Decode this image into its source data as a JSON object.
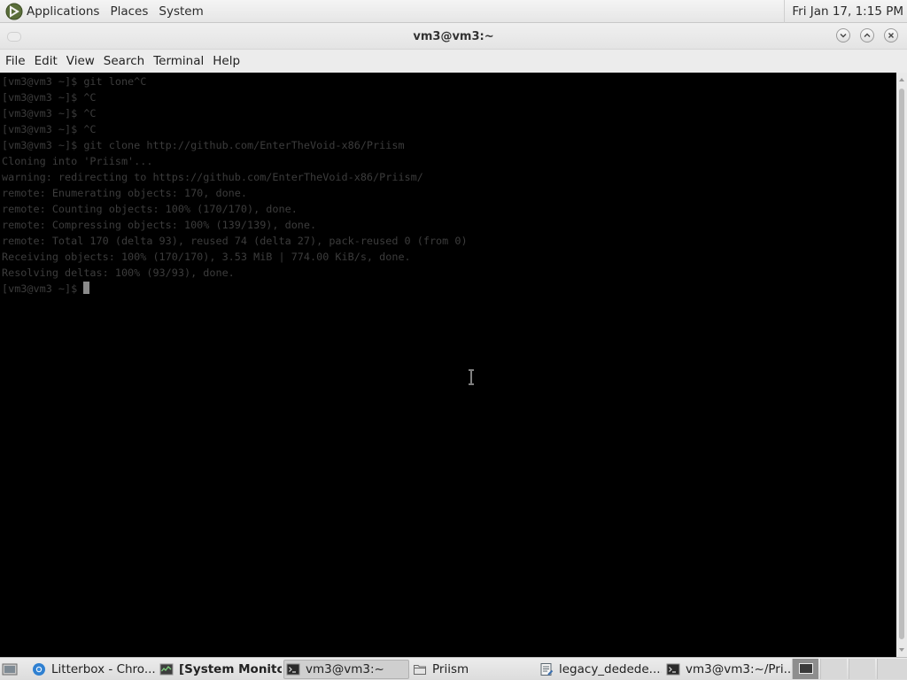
{
  "top_panel": {
    "menus": [
      "Applications",
      "Places",
      "System"
    ],
    "clock": "Fri Jan 17,  1:15 PM"
  },
  "window": {
    "title": "vm3@vm3:~"
  },
  "menubar": {
    "items": [
      "File",
      "Edit",
      "View",
      "Search",
      "Terminal",
      "Help"
    ]
  },
  "terminal": {
    "lines": [
      "[vm3@vm3 ~]$ git lone^C",
      "[vm3@vm3 ~]$ ^C",
      "[vm3@vm3 ~]$ ^C",
      "[vm3@vm3 ~]$ ^C",
      "[vm3@vm3 ~]$ git clone http://github.com/EnterTheVoid-x86/Priism",
      "Cloning into 'Priism'...",
      "warning: redirecting to https://github.com/EnterTheVoid-x86/Priism/",
      "remote: Enumerating objects: 170, done.",
      "remote: Counting objects: 100% (170/170), done.",
      "remote: Compressing objects: 100% (139/139), done.",
      "remote: Total 170 (delta 93), reused 74 (delta 27), pack-reused 0 (from 0)",
      "Receiving objects: 100% (170/170), 3.53 MiB | 774.00 KiB/s, done.",
      "Resolving deltas: 100% (93/93), done."
    ],
    "prompt": "[vm3@vm3 ~]$ "
  },
  "taskbar": {
    "tasks": [
      {
        "label": "Litterbox - Chro...",
        "icon": "chrome-icon"
      },
      {
        "label": "[System Monitor]",
        "icon": "system-monitor-icon"
      },
      {
        "label": "vm3@vm3:~",
        "icon": "terminal-icon"
      },
      {
        "label": "Priism",
        "icon": "folder-icon"
      },
      {
        "label": "legacy_dedede....",
        "icon": "text-editor-icon"
      },
      {
        "label": "vm3@vm3:~/Pri...",
        "icon": "terminal-icon"
      }
    ]
  }
}
